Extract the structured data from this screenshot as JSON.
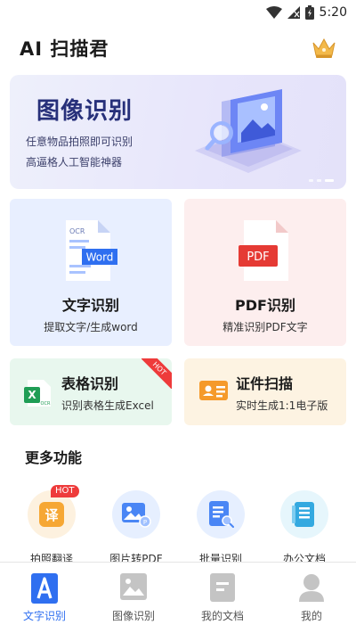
{
  "status_bar": {
    "time": "5:20"
  },
  "header": {
    "title": "AI 扫描君"
  },
  "banner": {
    "title": "图像识别",
    "subtitle_1": "任意物品拍照即可识别",
    "subtitle_2": "高逼格人工智能神器"
  },
  "cards": {
    "word": {
      "title": "文字识别",
      "desc": "提取文字/生成word",
      "icon_top_text": "OCR",
      "icon_badge": "Word"
    },
    "pdf": {
      "title": "PDF识别",
      "desc": "精准识别PDF文字",
      "icon_badge": "PDF"
    },
    "excel": {
      "title": "表格识别",
      "desc": "识别表格生成Excel",
      "ribbon": "HOT",
      "icon_letter": "X",
      "icon_sub": "OCR"
    },
    "idcard": {
      "title": "证件扫描",
      "desc": "实时生成1:1电子版"
    }
  },
  "more": {
    "title": "更多功能",
    "items": [
      {
        "label": "拍照翻译",
        "icon": "translate-icon",
        "glyph": "译",
        "badge": "HOT"
      },
      {
        "label": "图片转PDF",
        "icon": "image-to-pdf-icon"
      },
      {
        "label": "批量识别",
        "icon": "batch-scan-icon"
      },
      {
        "label": "办公文档",
        "icon": "office-doc-icon"
      }
    ]
  },
  "bottom_nav": {
    "items": [
      {
        "label": "文字识别",
        "icon": "text-recognition-icon",
        "active": true
      },
      {
        "label": "图像识别",
        "icon": "image-recognition-icon"
      },
      {
        "label": "我的文档",
        "icon": "documents-icon"
      },
      {
        "label": "我的",
        "icon": "profile-icon"
      }
    ]
  },
  "colors": {
    "accent": "#2f6ff0",
    "hot": "#ee3b3b",
    "banner_title": "#27307a",
    "word_card_bg": "#e8efff",
    "pdf_card_bg": "#fdeeee",
    "excel_card_bg": "#e8f7ee",
    "id_card_bg": "#fdf3e2"
  }
}
